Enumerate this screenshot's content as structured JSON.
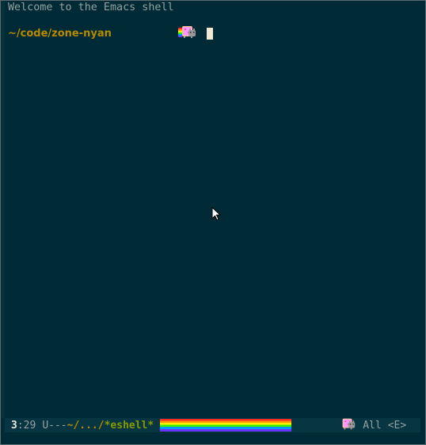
{
  "buffer": {
    "welcome_text": "Welcome to the Emacs shell",
    "prompt_path": "~/code/zone-nyan"
  },
  "modeline": {
    "line_number": "3",
    "column": ":29",
    "state": "U---",
    "directory": "~/.../",
    "buffer_name": "*eshell*",
    "position": "All",
    "evil_state": "<E>"
  },
  "icons": {
    "prompt": "nyan-cat-icon",
    "modeline": "nyan-cat-icon",
    "pointer": "mouse-pointer-icon"
  },
  "colors": {
    "background": "#002b36",
    "prompt": "#b58900",
    "buffer_name": "#859900",
    "modeline_bg": "#073642"
  }
}
